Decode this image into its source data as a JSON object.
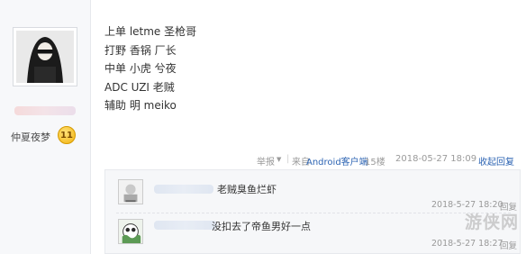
{
  "author": {
    "name": "仲夏夜梦",
    "level": "11"
  },
  "post_lines": [
    "上单 letme 圣枪哥",
    "打野 香锅 厂长",
    "中单 小虎 兮夜",
    "ADC UZI 老贼",
    "辅助 明 meiko"
  ],
  "meta": {
    "report_label": "举报",
    "from_prefix": "来自",
    "source_label": "Android客户端",
    "floor": "15楼",
    "time": "2018-05-27 18:09",
    "collapse_reply_label": "收起回复",
    "separator": "|"
  },
  "replies": [
    {
      "text": "老贼臭鱼烂虾",
      "time": "2018-5-27 18:20",
      "action": "回复"
    },
    {
      "text": "没扣去了帝鱼男好一点",
      "time": "2018-5-27 18:27",
      "action": "回复"
    }
  ],
  "watermark": "游侠网",
  "colors": {
    "link": "#2d64b3",
    "meta_gray": "#9a9a9a",
    "reply_bg": "#f6f7f9",
    "badge_gold": "#f2b20c"
  },
  "icons": [
    "dropdown-caret-icon",
    "level-badge-icon"
  ]
}
